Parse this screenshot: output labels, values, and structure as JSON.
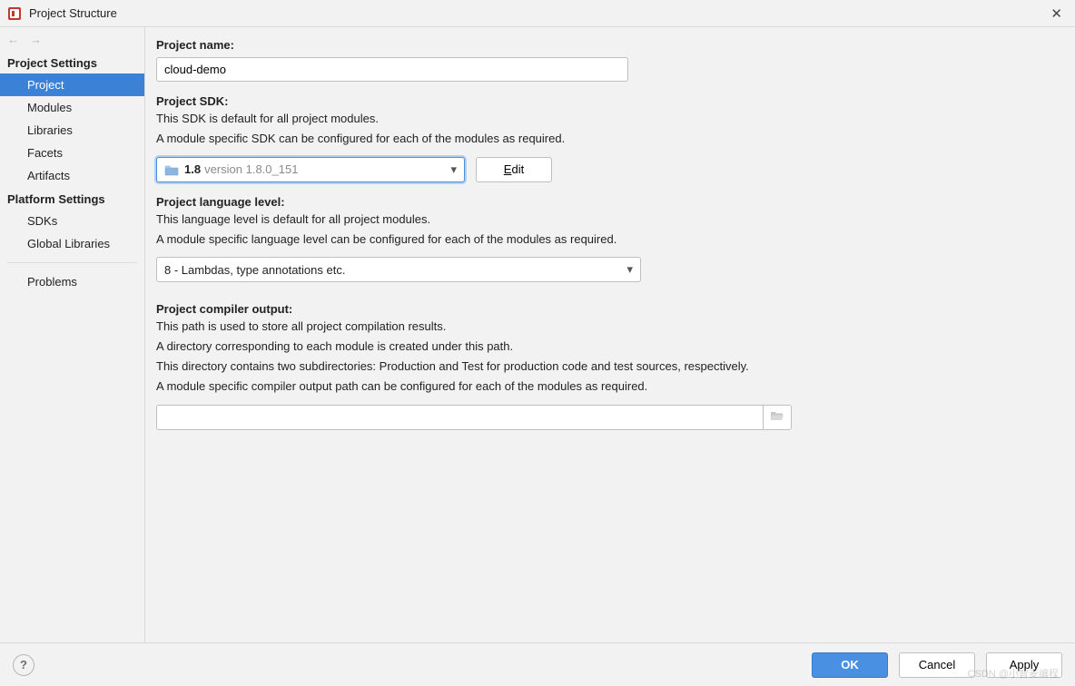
{
  "window": {
    "title": "Project Structure"
  },
  "sidebar": {
    "section_project": "Project Settings",
    "items_project": [
      {
        "label": "Project",
        "selected": true
      },
      {
        "label": "Modules"
      },
      {
        "label": "Libraries"
      },
      {
        "label": "Facets"
      },
      {
        "label": "Artifacts"
      }
    ],
    "section_platform": "Platform Settings",
    "items_platform": [
      {
        "label": "SDKs"
      },
      {
        "label": "Global Libraries"
      }
    ],
    "problems": "Problems"
  },
  "main": {
    "project_name_label": "Project name:",
    "project_name_value": "cloud-demo",
    "sdk_label": "Project SDK:",
    "sdk_desc_1": "This SDK is default for all project modules.",
    "sdk_desc_2": "A module specific SDK can be configured for each of the modules as required.",
    "sdk_selected_major": "1.8",
    "sdk_selected_version": "version 1.8.0_151",
    "edit_label": "Edit",
    "lang_level_label": "Project language level:",
    "lang_desc_1": "This language level is default for all project modules.",
    "lang_desc_2": "A module specific language level can be configured for each of the modules as required.",
    "lang_level_value": "8 - Lambdas, type annotations etc.",
    "output_label": "Project compiler output:",
    "output_desc_1": "This path is used to store all project compilation results.",
    "output_desc_2": "A directory corresponding to each module is created under this path.",
    "output_desc_3": "This directory contains two subdirectories: Production and Test for production code and test sources, respectively.",
    "output_desc_4": "A module specific compiler output path can be configured for each of the modules as required.",
    "output_value": ""
  },
  "footer": {
    "help": "?",
    "ok": "OK",
    "cancel": "Cancel",
    "apply": "Apply",
    "watermark": "CSDN @小智麦编程"
  },
  "icons": {
    "back": "←",
    "forward": "→",
    "close": "✕",
    "dropdown": "▾"
  }
}
